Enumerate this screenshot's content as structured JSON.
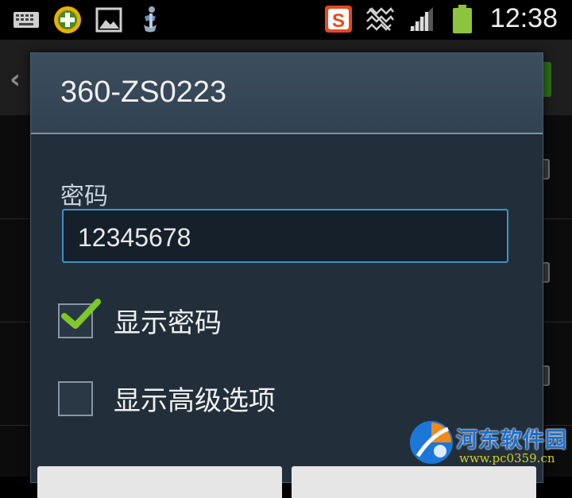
{
  "status_bar": {
    "time": "12:38",
    "left_icons": [
      "keyboard-icon",
      "app-plus-icon",
      "gallery-icon",
      "sync-icon"
    ],
    "right_icons": [
      "sogou-input-icon",
      "wifi-off-icon",
      "signal-icon",
      "battery-icon"
    ],
    "battery_color": "#8bc53f"
  },
  "dialog": {
    "title": "360-ZS0223",
    "password_label": "密码",
    "password_value": "12345678",
    "show_password": {
      "label": "显示密码",
      "checked": true
    },
    "show_advanced": {
      "label": "显示高级选项",
      "checked": false
    }
  },
  "watermark": {
    "name": "河东软件园",
    "url": "www.pc0359.cn"
  },
  "colors": {
    "accent": "#3c93c8",
    "check": "#7ec82a",
    "dialog_bg": "#222f3b"
  }
}
